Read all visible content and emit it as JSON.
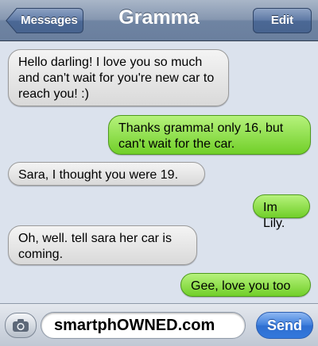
{
  "header": {
    "back_label": "Messages",
    "title": "Gramma",
    "edit_label": "Edit"
  },
  "messages": [
    {
      "direction": "received",
      "text": "Hello darling! I love you so much and can't wait for you're new car to reach you! :)"
    },
    {
      "direction": "sent",
      "text": "Thanks gramma! only 16, but can't wait for the car."
    },
    {
      "direction": "received",
      "text": "Sara, I thought you were 19."
    },
    {
      "direction": "sent",
      "text": "Im Lily."
    },
    {
      "direction": "received",
      "text": "Oh, well. tell sara her car is coming."
    },
    {
      "direction": "sent",
      "text": "Gee, love you too"
    }
  ],
  "composer": {
    "field_value": "smartphOWNED.com",
    "send_label": "Send",
    "camera_icon": "camera-icon"
  },
  "colors": {
    "received_bubble": "#e8e8e8",
    "sent_bubble": "#8fe04a",
    "send_button": "#3f7fdc",
    "header": "#7d8fab"
  }
}
